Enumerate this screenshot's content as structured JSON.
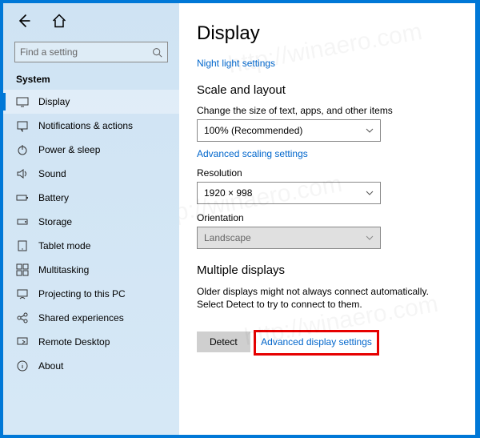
{
  "search": {
    "placeholder": "Find a setting"
  },
  "section": "System",
  "nav": [
    "Display",
    "Notifications & actions",
    "Power & sleep",
    "Sound",
    "Battery",
    "Storage",
    "Tablet mode",
    "Multitasking",
    "Projecting to this PC",
    "Shared experiences",
    "Remote Desktop",
    "About"
  ],
  "main": {
    "title": "Display",
    "night_link": "Night light settings",
    "scale_heading": "Scale and layout",
    "scale_label": "Change the size of text, apps, and other items",
    "scale_value": "100% (Recommended)",
    "adv_scaling_link": "Advanced scaling settings",
    "res_label": "Resolution",
    "res_value": "1920 × 998",
    "orient_label": "Orientation",
    "orient_value": "Landscape",
    "multi_heading": "Multiple displays",
    "multi_desc": "Older displays might not always connect automatically. Select Detect to try to connect to them.",
    "detect_btn": "Detect",
    "adv_display_link": "Advanced display settings"
  }
}
